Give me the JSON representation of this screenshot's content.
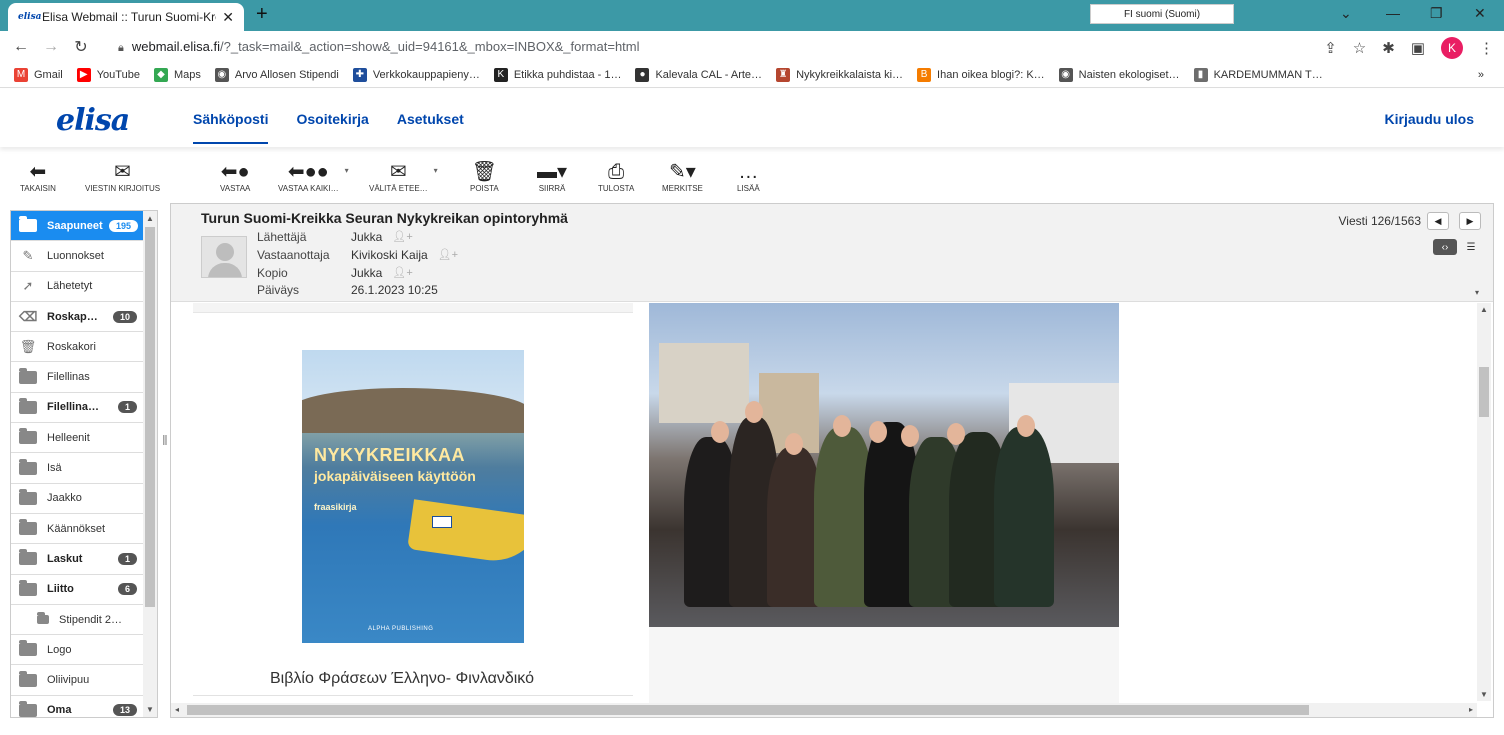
{
  "browser": {
    "tab_title": "Elisa Webmail :: Turun Suomi-Kre",
    "tab_close": "✕",
    "new_tab": "+",
    "language_badge": "FI  suomi (Suomi)",
    "url_host": "webmail.elisa.fi",
    "url_path": "/?_task=mail&_action=show&_uid=94161&_mbox=INBOX&_format=html",
    "profile_initial": "K",
    "bookmarks": [
      {
        "label": "Gmail",
        "color": "#ea4335",
        "glyph": "M"
      },
      {
        "label": "YouTube",
        "color": "#ff0000",
        "glyph": "▶"
      },
      {
        "label": "Maps",
        "color": "#34a853",
        "glyph": "◆"
      },
      {
        "label": "Arvo Allosen Stipendi",
        "color": "#555555",
        "glyph": "◉"
      },
      {
        "label": "Verkkokauppapieny…",
        "color": "#1f4e9c",
        "glyph": "✚"
      },
      {
        "label": "Etikka puhdistaa - 1…",
        "color": "#222222",
        "glyph": "K"
      },
      {
        "label": "Kalevala CAL - Arte…",
        "color": "#333333",
        "glyph": "●"
      },
      {
        "label": "Nykykreikkalaista ki…",
        "color": "#b5462f",
        "glyph": "♜"
      },
      {
        "label": "Ihan oikea blogi?: K…",
        "color": "#f57c00",
        "glyph": "B"
      },
      {
        "label": "Naisten ekologiset…",
        "color": "#555555",
        "glyph": "◉"
      },
      {
        "label": "KARDEMUMMAN T…",
        "color": "#6d6d6d",
        "glyph": "▮"
      }
    ],
    "bookmarks_more": "»"
  },
  "app": {
    "logo": "elisa",
    "nav": [
      "Sähköposti",
      "Osoitekirja",
      "Asetukset"
    ],
    "logout": "Kirjaudu ulos"
  },
  "toolbar": {
    "back": "TAKAISIN",
    "compose": "VIESTIN KIRJOITUS",
    "reply": "VASTAA",
    "reply_all": "VASTAA KAIKI…",
    "forward": "VÄLITÄ ETEE…",
    "delete": "POISTA",
    "move": "SIIRRÄ",
    "print": "TULOSTA",
    "mark": "MERKITSE",
    "more": "LISÄÄ"
  },
  "folders": [
    {
      "name": "Saapuneet",
      "count": "195",
      "bold": true,
      "selected": true,
      "icon": "folder-icon"
    },
    {
      "name": "Luonnokset",
      "count": "",
      "bold": false,
      "icon": "pencil-icon"
    },
    {
      "name": "Lähetetyt",
      "count": "",
      "bold": false,
      "icon": "sent-icon"
    },
    {
      "name": "Roskap…",
      "count": "10",
      "bold": true,
      "icon": "junk-icon"
    },
    {
      "name": "Roskakori",
      "count": "",
      "bold": false,
      "icon": "trash-icon"
    },
    {
      "name": "Filellinas",
      "count": "",
      "bold": false,
      "icon": "folder-icon"
    },
    {
      "name": "Filellina…",
      "count": "1",
      "bold": true,
      "icon": "folder-icon"
    },
    {
      "name": "Helleenit",
      "count": "",
      "bold": false,
      "icon": "folder-icon"
    },
    {
      "name": "Isä",
      "count": "",
      "bold": false,
      "icon": "folder-icon"
    },
    {
      "name": "Jaakko",
      "count": "",
      "bold": false,
      "icon": "folder-icon"
    },
    {
      "name": "Käännökset",
      "count": "",
      "bold": false,
      "icon": "folder-icon"
    },
    {
      "name": "Laskut",
      "count": "1",
      "bold": true,
      "icon": "folder-icon"
    },
    {
      "name": "Liitto",
      "count": "6",
      "bold": true,
      "icon": "folder-icon"
    },
    {
      "name": "Stipendit 2…",
      "count": "",
      "bold": false,
      "sub": true,
      "icon": "folder-icon"
    },
    {
      "name": "Logo",
      "count": "",
      "bold": false,
      "icon": "folder-icon"
    },
    {
      "name": "Oliivipuu",
      "count": "",
      "bold": false,
      "icon": "folder-icon"
    },
    {
      "name": "Oma",
      "count": "13",
      "bold": true,
      "icon": "folder-icon"
    }
  ],
  "message": {
    "subject": "Turun Suomi-Kreikka Seuran Nykykreikan opintoryhmä",
    "from_label": "Lähettäjä",
    "from": "Jukka",
    "to_label": "Vastaanottaja",
    "to": "Kivikoski Kaija",
    "cc_label": "Kopio",
    "cc": "Jukka",
    "date_label": "Päiväys",
    "date": "26.1.2023 10:25",
    "counter": "Viesti 126/1563"
  },
  "body": {
    "book_title_line1": "NYKYKREIKKAA",
    "book_title_line2": "jokapäiväiseen käyttöön",
    "book_subtitle": "fraasikirja",
    "book_publisher": "ALPHA PUBLISHING",
    "caption": "Βιβλίο Φράσεων Έλληνο- Φινλανδικό"
  },
  "colors": {
    "brand": "#0046ad",
    "tabbar": "#3c99a6",
    "selected_folder": "#1a8cf0"
  }
}
